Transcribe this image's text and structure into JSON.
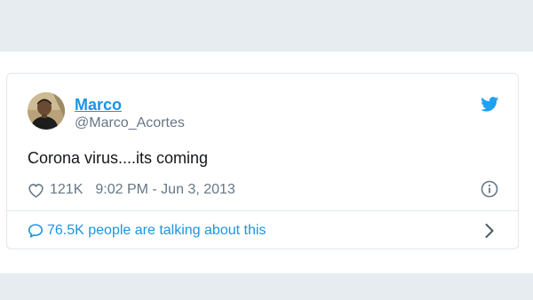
{
  "tweet": {
    "author_name": "Marco",
    "author_handle": "@Marco_Acortes",
    "text": "Corona virus....its coming",
    "likes": "121K",
    "timestamp": "9:02 PM - Jun 3, 2013",
    "talking": "76.5K people are talking about this"
  },
  "icons": {
    "brand": "twitter-bird-icon",
    "like": "heart-icon",
    "info": "info-icon",
    "conversation": "speech-bubble-icon",
    "more": "chevron-right-icon"
  },
  "colors": {
    "background_band": "#e6ecf0",
    "link_blue": "#1b95e0",
    "twitter_blue": "#1da1f2",
    "text_dark": "#14171a",
    "text_muted": "#657786",
    "border": "#e1e8ed"
  }
}
